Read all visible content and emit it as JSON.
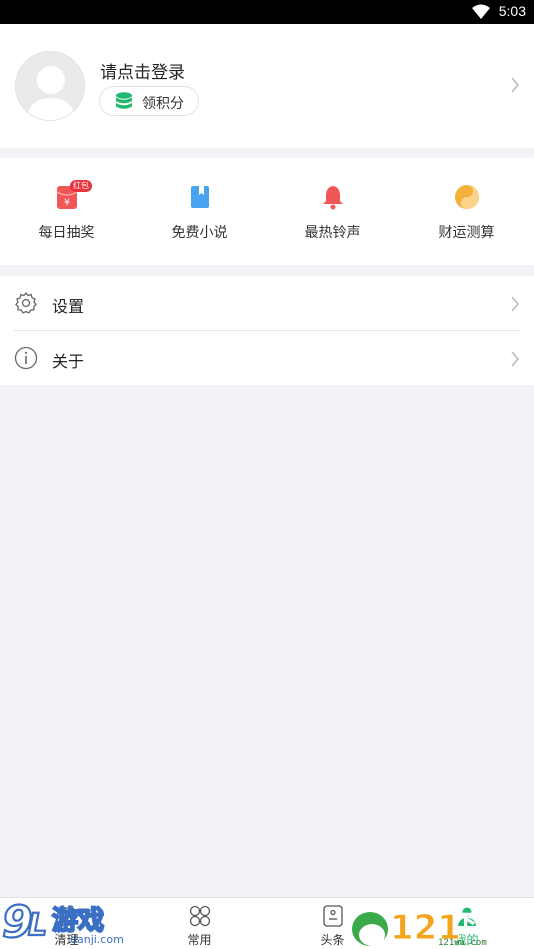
{
  "status": {
    "time": "5:03"
  },
  "profile": {
    "title": "请点击登录",
    "points_label": "领积分"
  },
  "quick": [
    {
      "label": "每日抽奖",
      "icon": "red-envelope-icon",
      "badge": "红包"
    },
    {
      "label": "免费小说",
      "icon": "book-icon"
    },
    {
      "label": "最热铃声",
      "icon": "bell-icon"
    },
    {
      "label": "财运测算",
      "icon": "yin-yang-icon"
    }
  ],
  "menu": [
    {
      "label": "设置",
      "icon": "gear-icon"
    },
    {
      "label": "关于",
      "icon": "info-icon"
    }
  ],
  "tabs": [
    {
      "label": "清理",
      "icon": "clean-icon"
    },
    {
      "label": "常用",
      "icon": "grid-icon"
    },
    {
      "label": "头条",
      "icon": "news-icon"
    },
    {
      "label": "我的",
      "icon": "profile-icon"
    }
  ],
  "watermarks": {
    "left": {
      "brand": "9游戏",
      "url": "danji.com"
    },
    "right": {
      "brand": "121下载站",
      "url": "121wu.com"
    }
  },
  "colors": {
    "accent_green": "#22b86f",
    "red": "#f05656",
    "blue": "#4aa3f0",
    "gold": "#f3b03a",
    "page_bg": "#f2f3f7"
  }
}
